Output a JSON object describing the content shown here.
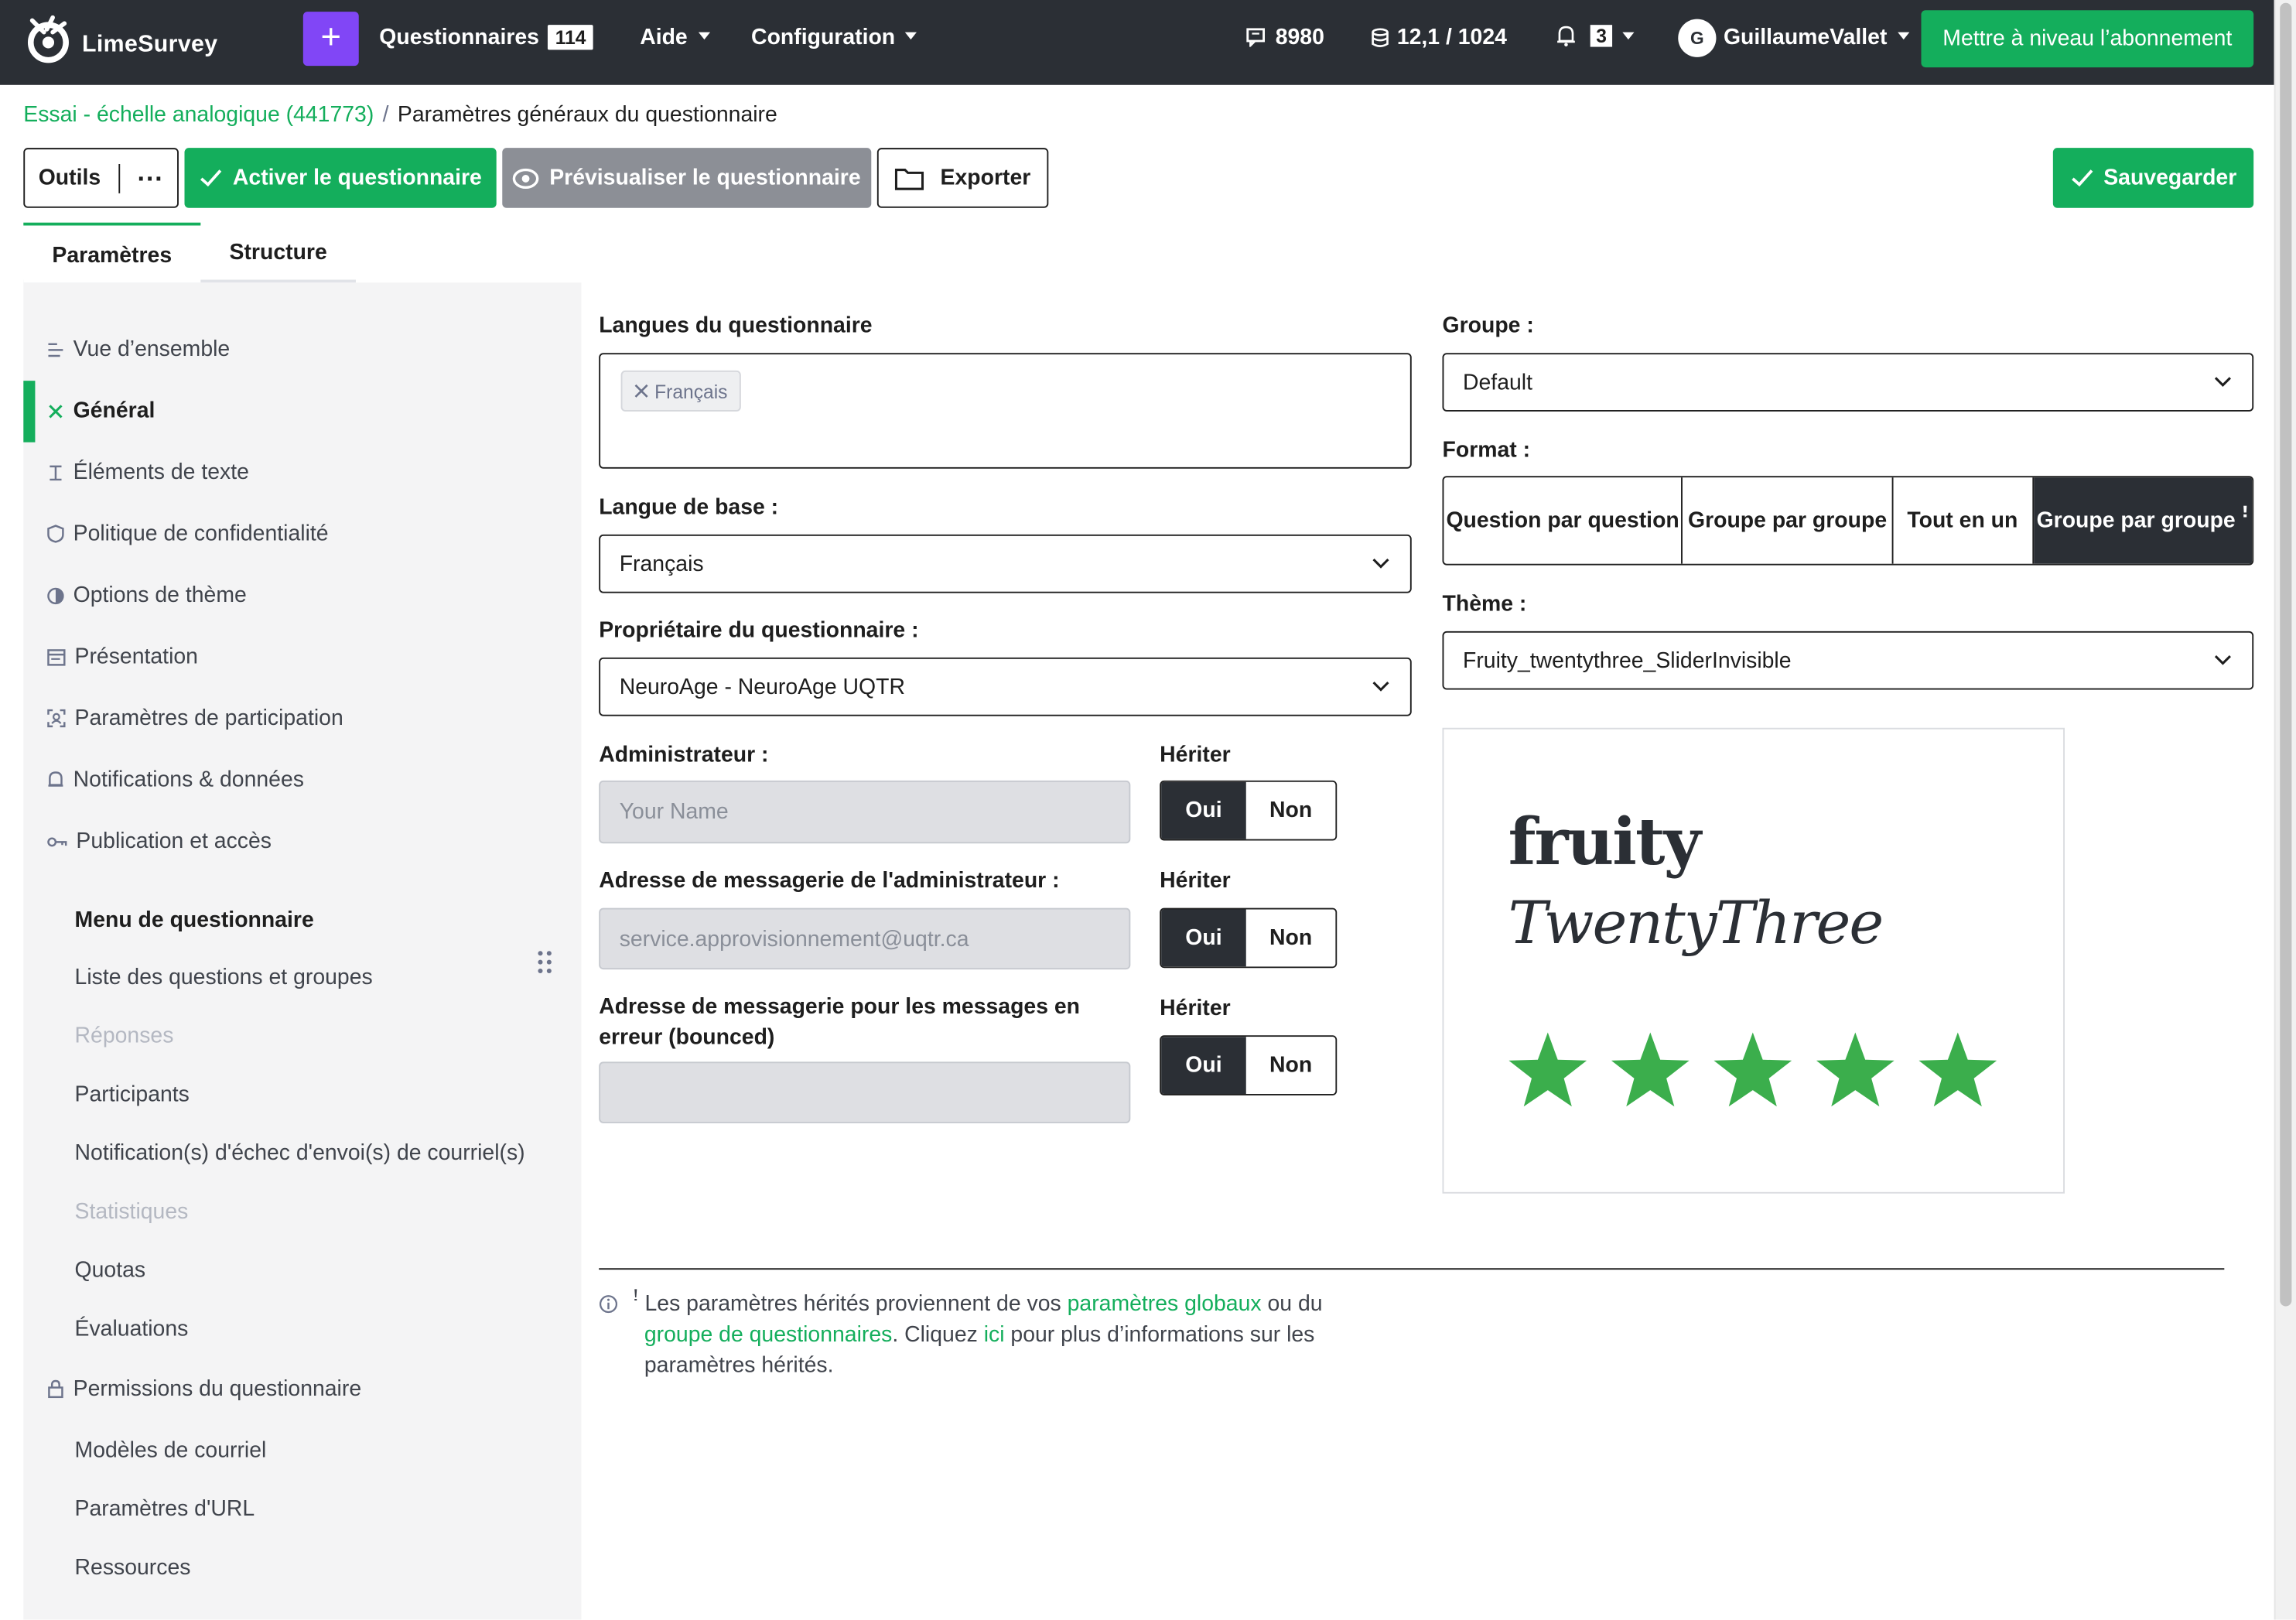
{
  "navbar": {
    "brand": "LimeSurvey",
    "plus": "+",
    "questionnaires_label": "Questionnaires",
    "questionnaires_count": "114",
    "help_label": "Aide",
    "config_label": "Configuration",
    "responses_stat": "8980",
    "storage_stat": "12,1 / 1024",
    "notifications_count": "3",
    "avatar_initial": "G",
    "username": "GuillaumeVallet",
    "upgrade_label": "Mettre à niveau l’abonnement"
  },
  "breadcrumb": {
    "survey_link": "Essai - échelle analogique (441773)",
    "separator": "/",
    "current": "Paramètres généraux du questionnaire"
  },
  "toolbar": {
    "tools_label": "Outils",
    "more_label": "···",
    "activate_label": "Activer le questionnaire",
    "preview_label": "Prévisualiser le questionnaire",
    "export_label": "Exporter",
    "save_label": "Sauvegarder"
  },
  "tabs": [
    {
      "label": "Paramètres",
      "active": true
    },
    {
      "label": "Structure",
      "active": false
    }
  ],
  "sidebar": {
    "items": [
      {
        "label": "Vue d’ensemble",
        "icon": "overview-icon"
      },
      {
        "label": "Général",
        "icon": "tools-icon",
        "active": true
      },
      {
        "label": "Éléments de texte",
        "icon": "text-cursor-icon"
      },
      {
        "label": "Politique de confidentialité",
        "icon": "shield-icon"
      },
      {
        "label": "Options de thème",
        "icon": "contrast-icon"
      },
      {
        "label": "Présentation",
        "icon": "presentation-icon"
      },
      {
        "label": "Paramètres de participation",
        "icon": "participants-icon"
      },
      {
        "label": "Notifications & données",
        "icon": "bell-icon"
      },
      {
        "label": "Publication et accès",
        "icon": "key-icon"
      }
    ],
    "menu_heading": "Menu de questionnaire",
    "menu_items": [
      {
        "label": "Liste des questions et groupes",
        "disabled": false
      },
      {
        "label": "Réponses",
        "disabled": true
      },
      {
        "label": "Participants",
        "disabled": false
      },
      {
        "label": "Notification(s) d'échec d'envoi(s) de courriel(s)",
        "disabled": false
      },
      {
        "label": "Statistiques",
        "disabled": true
      },
      {
        "label": "Quotas",
        "disabled": false
      },
      {
        "label": "Évaluations",
        "disabled": false
      }
    ],
    "permissions_label": "Permissions du questionnaire",
    "extra_items": [
      {
        "label": "Modèles de courriel"
      },
      {
        "label": "Paramètres d'URL"
      },
      {
        "label": "Ressources"
      }
    ]
  },
  "form": {
    "languages_label": "Langues du questionnaire",
    "language_tag": "Français",
    "base_language_label": "Langue de base :",
    "base_language_value": "Français",
    "owner_label": "Propriétaire du questionnaire :",
    "owner_value": "NeuroAge - NeuroAge UQTR",
    "admin_label": "Administrateur :",
    "admin_placeholder": "Your Name",
    "admin_email_label": "Adresse de messagerie de l'administrateur :",
    "admin_email_placeholder": "service.approvisionnement@uqtr.ca",
    "bounce_label": "Adresse de messagerie pour les messages en erreur (bounced)",
    "inherit_label": "Hériter",
    "yes_label": "Oui",
    "no_label": "Non",
    "group_label": "Groupe :",
    "group_value": "Default",
    "format_label": "Format :",
    "format_options": [
      "Question par question",
      "Groupe par groupe",
      "Tout en un",
      "Groupe par groupe ꜝ"
    ],
    "format_selected": 3,
    "theme_label": "Thème :",
    "theme_value": "Fruity_twentythree_SliderInvisible",
    "theme_preview_line1": "fruity",
    "theme_preview_line2": "TwentyThree",
    "theme_preview_rating": 5
  },
  "note": {
    "prefix": "ꜝ Les paramètres hérités proviennent de vos ",
    "link1": "paramètres globaux",
    "mid": " ou du ",
    "link2": "groupe de questionnaires",
    "mid2": ". Cliquez ",
    "link3": "ici",
    "suffix": " pour plus d’informations sur les paramètres hérités."
  },
  "colors": {
    "navbar": "#2b2f35",
    "accent_green": "#14ae5c",
    "purple": "#8146f6",
    "star_green": "#3bae4c"
  }
}
